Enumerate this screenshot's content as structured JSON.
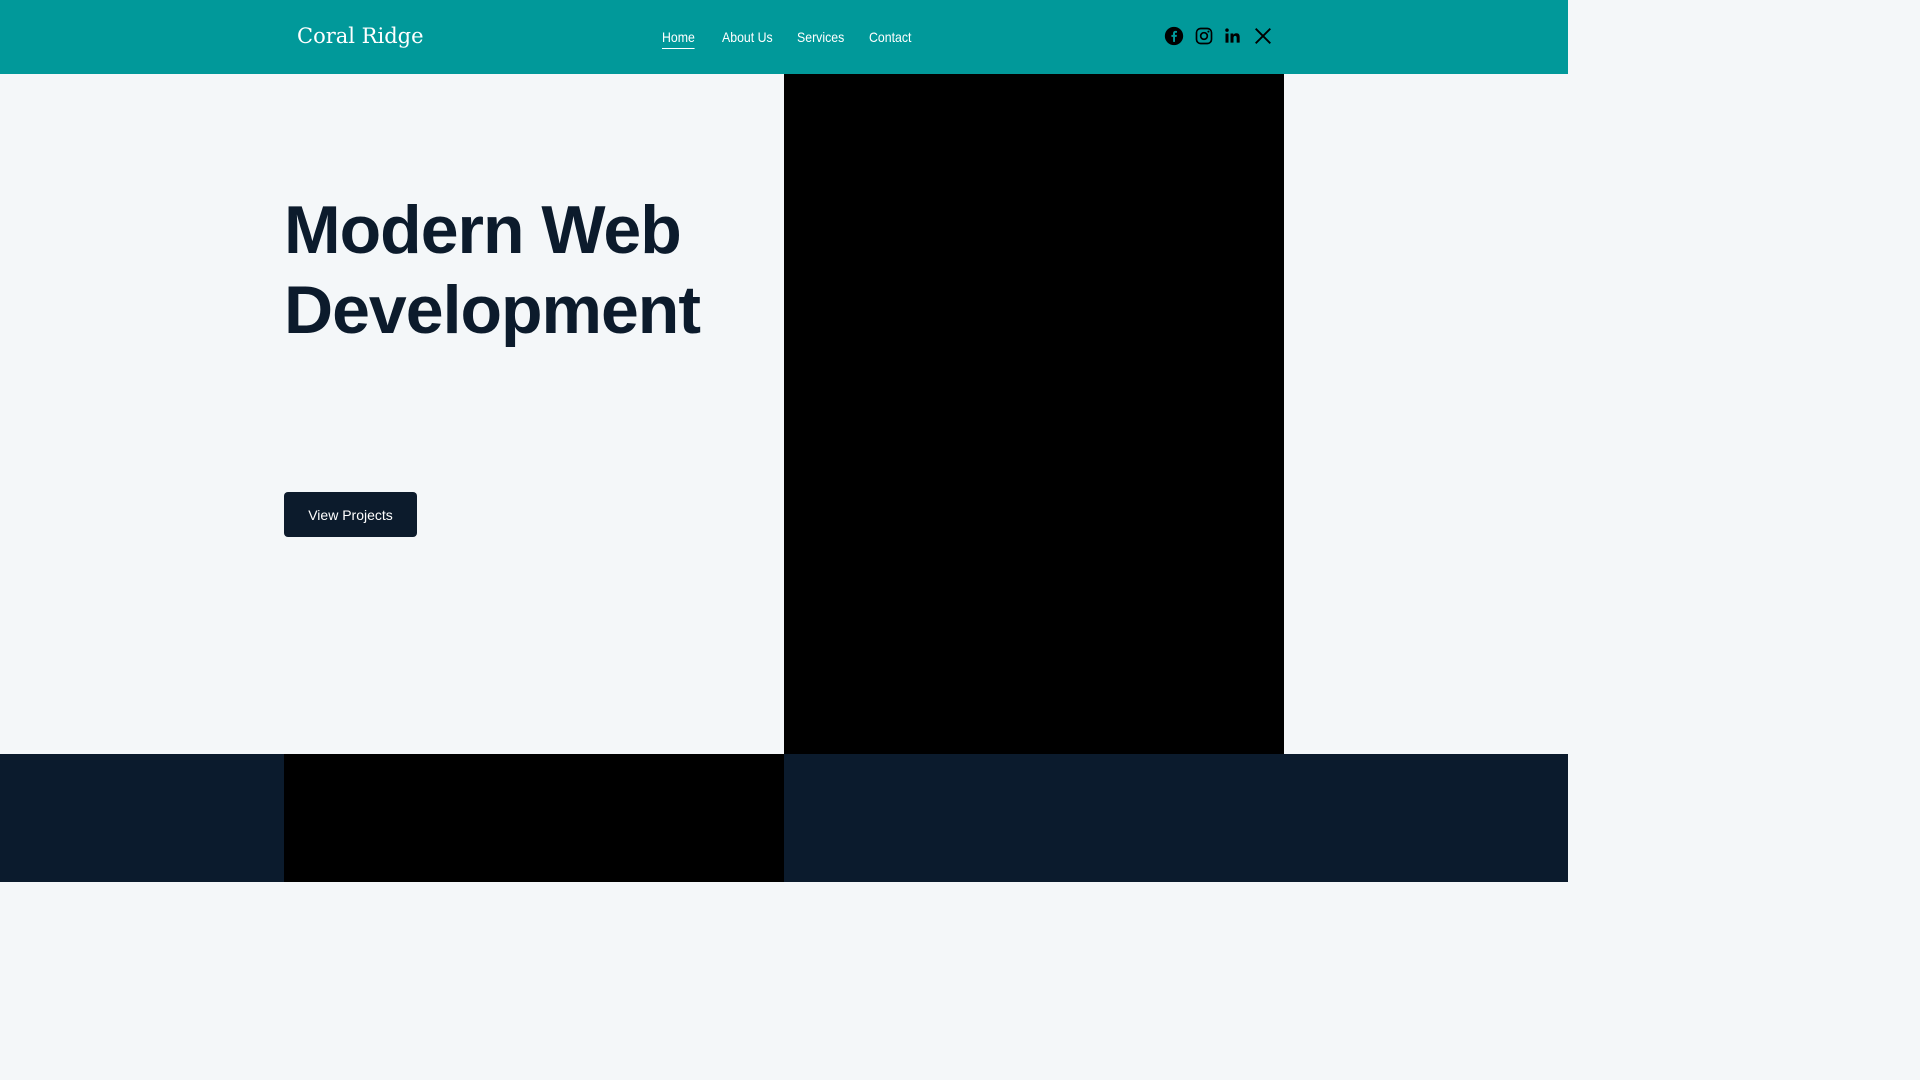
{
  "header": {
    "brand": "Coral Ridge",
    "nav": [
      {
        "label": "Home",
        "active": true
      },
      {
        "label": "About Us",
        "active": false
      },
      {
        "label": "Services",
        "active": false
      },
      {
        "label": "Contact",
        "active": false
      }
    ],
    "social_icons": [
      "facebook-icon",
      "instagram-icon",
      "linkedin-icon",
      "x-icon"
    ]
  },
  "hero": {
    "headline_line1": "Modern Web",
    "headline_line2": "Development",
    "cta_label": "View Projects"
  },
  "colors": {
    "header_bg": "#01999a",
    "page_bg": "#f4f7f9",
    "text_dark": "#0c1b2c",
    "button_bg": "#0c1b2c",
    "footer_bg": "#0b1b2d",
    "media_bg": "#000000"
  }
}
